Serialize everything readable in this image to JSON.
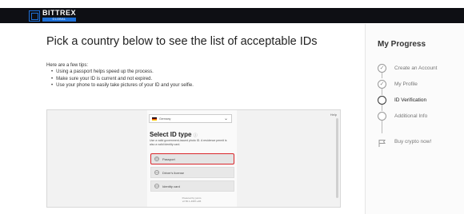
{
  "header": {
    "logo_word": "BITTREX",
    "logo_sub": "GLOBAL"
  },
  "main": {
    "title": "Pick a country below to see the list of acceptable IDs",
    "tips_heading": "Here are a few tips:",
    "tips": [
      "Using a passport helps speed up the process.",
      "Make sure your ID is current and not expired.",
      "Use your phone to easily take pictures of your ID and your selfie."
    ]
  },
  "embed": {
    "help_label": "Help",
    "country_value": "Germany",
    "idtype_title": "Select ID type",
    "idtype_desc": "Use a valid government-issued photo ID. A residence permit is also a valid identity card.",
    "options": [
      {
        "label": "Passport",
        "selected": true
      },
      {
        "label": "Driver's license",
        "selected": false
      },
      {
        "label": "Identity card",
        "selected": false
      }
    ],
    "powered_by": "Powered by jumio",
    "powered_sub": "v2.56.1-4987-e96"
  },
  "progress": {
    "title": "My Progress",
    "steps": [
      {
        "label": "Create an Account",
        "state": "done"
      },
      {
        "label": "My Profile",
        "state": "done"
      },
      {
        "label": "ID Verification",
        "state": "active"
      },
      {
        "label": "Additional Info",
        "state": "pending"
      },
      {
        "label": "Buy crypto now!",
        "state": "final"
      }
    ]
  },
  "colors": {
    "topbar": "#0e0f14",
    "brand_blue": "#1d6fd6",
    "highlight_red": "#d9262b"
  }
}
